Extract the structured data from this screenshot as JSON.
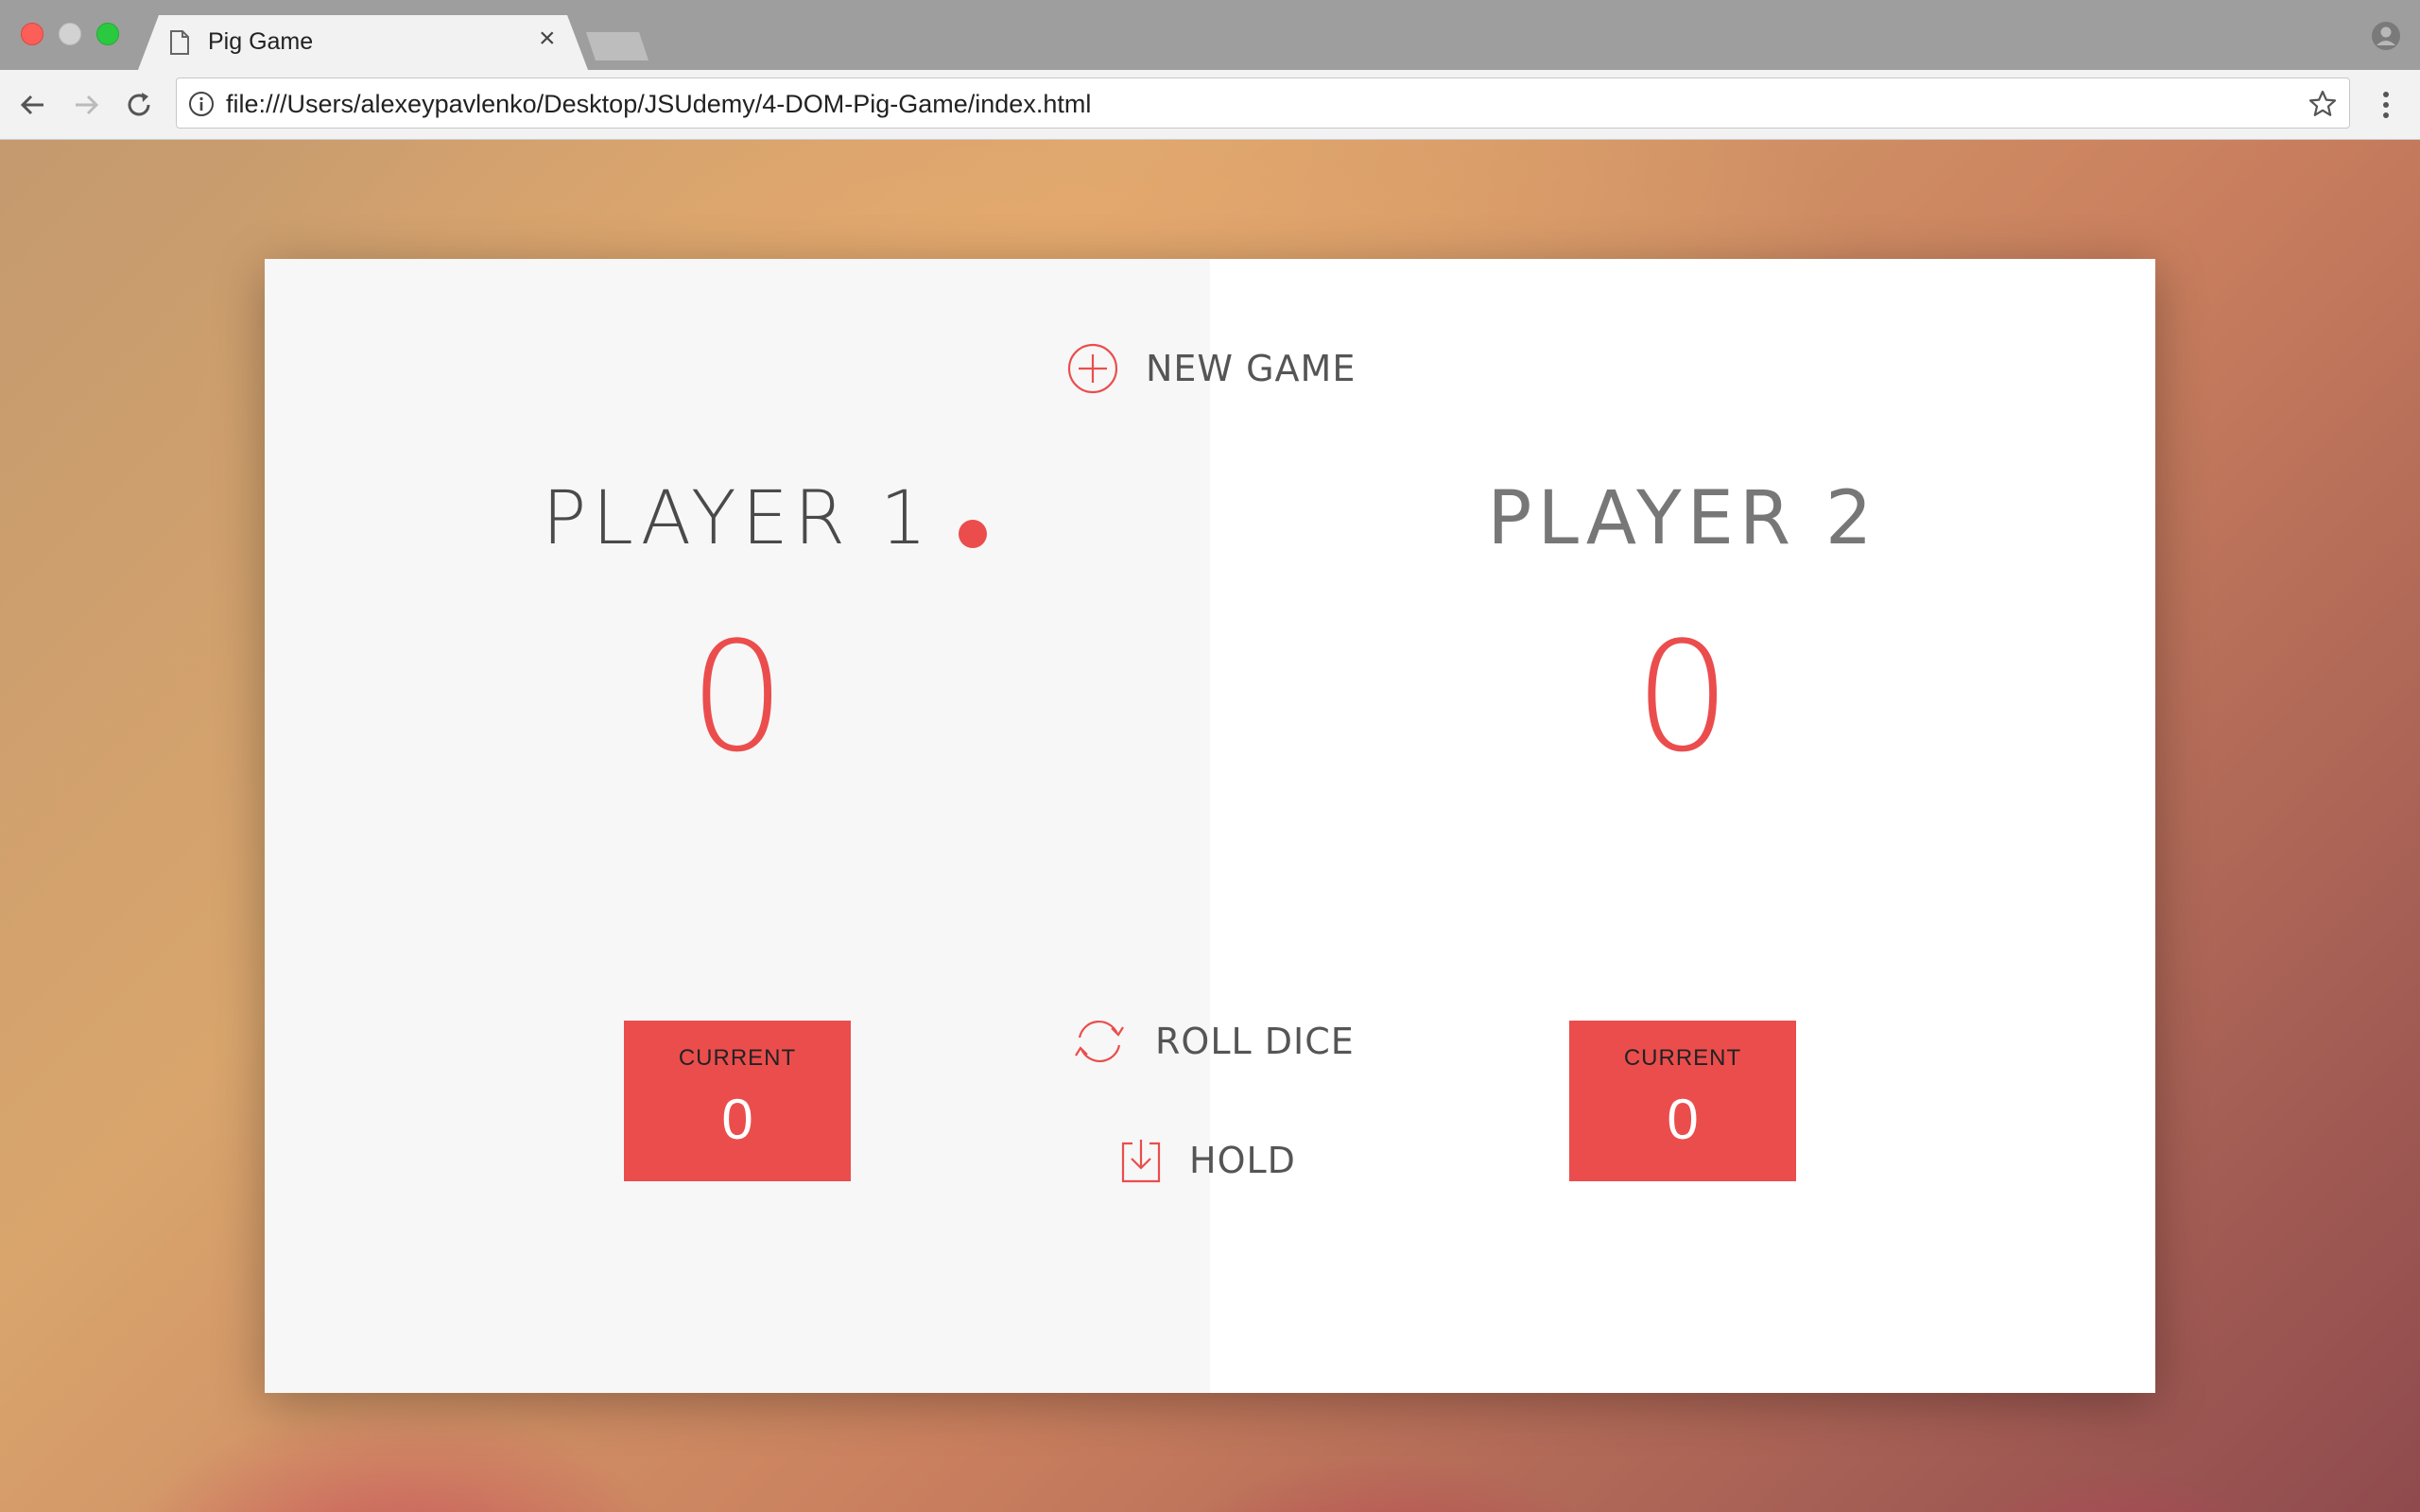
{
  "browser": {
    "tab_title": "Pig Game",
    "tab_close": "×",
    "url": "file:///Users/alexeypavlenko/Desktop/JSUdemy/4-DOM-Pig-Game/index.html"
  },
  "game": {
    "new_game_label": "NEW GAME",
    "roll_dice_label": "ROLL DICE",
    "hold_label": "HOLD",
    "accent_color": "#eb4d4d",
    "active_player": 0,
    "players": [
      {
        "name": "PLAYER 1",
        "score": "0",
        "current_label": "CURRENT",
        "current_score": "0"
      },
      {
        "name": "PLAYER 2",
        "score": "0",
        "current_label": "CURRENT",
        "current_score": "0"
      }
    ]
  }
}
